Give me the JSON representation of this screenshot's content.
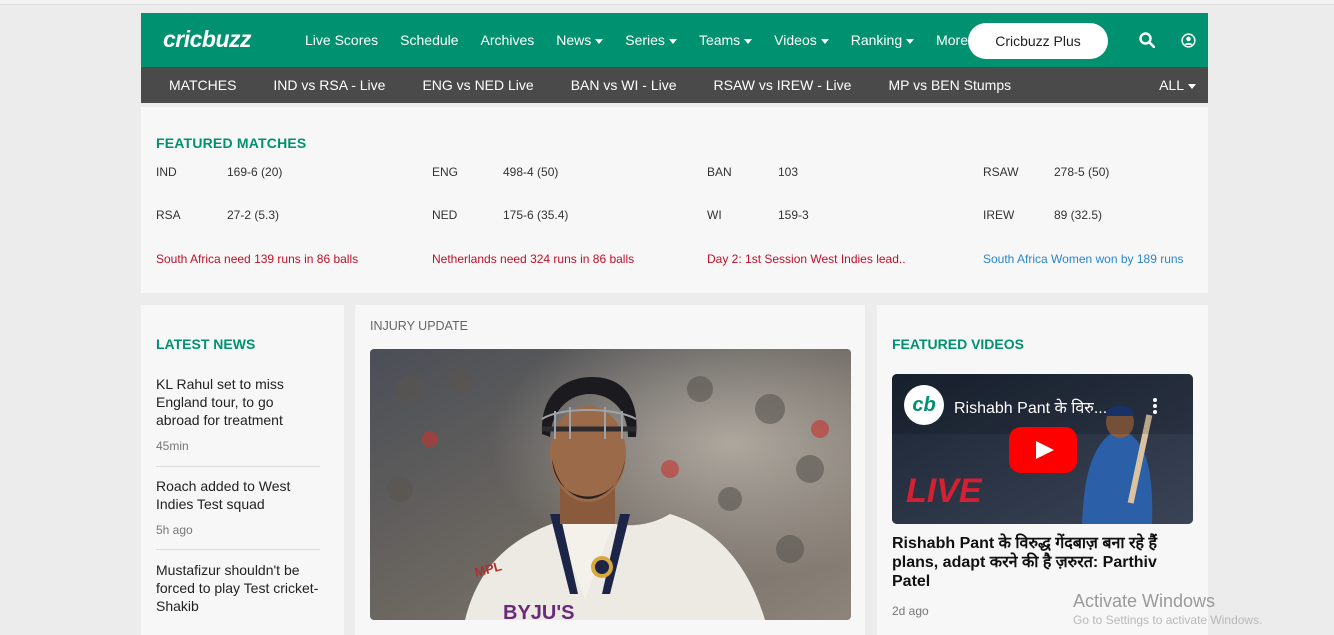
{
  "header": {
    "logo": "cricbuzz",
    "nav": [
      "Live Scores",
      "Schedule",
      "Archives",
      "News",
      "Series",
      "Teams",
      "Videos",
      "Ranking",
      "More"
    ],
    "nav_has_caret": [
      false,
      false,
      false,
      true,
      true,
      true,
      true,
      true,
      true
    ],
    "plus_button": "Cricbuzz Plus"
  },
  "subnav": {
    "items": [
      "MATCHES",
      "IND vs RSA - Live",
      "ENG vs NED Live",
      "BAN vs WI - Live",
      "RSAW vs IREW - Live",
      "MP vs BEN Stumps"
    ],
    "all": "ALL"
  },
  "featured": {
    "title": "FEATURED MATCHES",
    "matches": [
      {
        "team1": "IND",
        "score1": "169-6 (20)",
        "team2": "RSA",
        "score2": "27-2 (5.3)",
        "status": "South Africa need 139 runs in 86 balls",
        "status_color": "#c0102a"
      },
      {
        "team1": "ENG",
        "score1": "498-4 (50)",
        "team2": "NED",
        "score2": "175-6 (35.4)",
        "status": "Netherlands need 324 runs in 86 balls",
        "status_color": "#c0102a"
      },
      {
        "team1": "BAN",
        "score1": "103",
        "team2": "WI",
        "score2": "159-3",
        "status": "Day 2: 1st Session West Indies lead..",
        "status_color": "#c0102a"
      },
      {
        "team1": "RSAW",
        "score1": "278-5 (50)",
        "team2": "IREW",
        "score2": "89 (32.5)",
        "status": "South Africa Women won by 189 runs",
        "status_color": "#2a86cf"
      }
    ]
  },
  "latest_news": {
    "title": "LATEST NEWS",
    "items": [
      {
        "headline": "KL Rahul set to miss England tour, to go abroad for treatment",
        "time": "45min"
      },
      {
        "headline": "Roach added to West Indies Test squad",
        "time": "5h ago"
      },
      {
        "headline": "Mustafizur shouldn't be forced to play Test cricket- Shakib",
        "time": ""
      }
    ]
  },
  "injury": {
    "label": "INJURY UPDATE",
    "jersey_text": "BYJU'S",
    "helmet_text": "MPL"
  },
  "featured_videos": {
    "title": "FEATURED VIDEOS",
    "video_overlay_title": "Rishabh Pant के विरु...",
    "video_logo": "cb",
    "video_live_text": "LIVE",
    "video_title": "Rishabh Pant के विरुद्ध गेंदबाज़ बना रहे हैं plans, adapt करने की है ज़रुरत: Parthiv Patel",
    "video_time": "2d ago"
  },
  "watermark": {
    "line1": "Activate Windows",
    "line2": "Go to Settings to activate Windows."
  },
  "colors": {
    "brand": "#009270",
    "subnav": "#4a4a4a",
    "live_red": "#c0102a",
    "result_blue": "#2a86cf"
  }
}
